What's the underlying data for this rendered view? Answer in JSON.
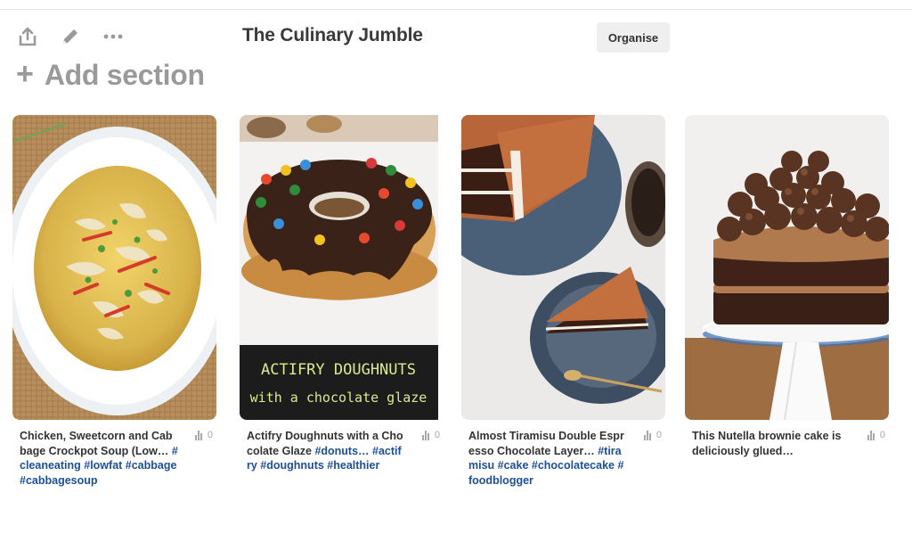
{
  "board": {
    "title": "The Culinary Jumble",
    "organise_label": "Organise",
    "add_section_label": "Add section"
  },
  "toolbar": {
    "icons": [
      "share-icon",
      "edit-pencil-icon",
      "more-options-icon"
    ]
  },
  "pins": [
    {
      "description": "Chicken, Sweetcorn and Cabbage Crockpot Soup (Low…",
      "tags": "#cleaneating #lowfat #cabbage #cabbagesoup",
      "stat": "0"
    },
    {
      "description": "Actifry Doughnuts with a Chocolate Glaze",
      "tags": "#donuts… #actifry #doughnuts #healthier",
      "stat": "0",
      "image_text_1": "ACTIFRY DOUGHNUTS",
      "image_text_2": "with a chocolate glaze"
    },
    {
      "description": "Almost Tiramisu Double Espresso Chocolate Layer…",
      "tags": "#tiramisu #cake #chocolatecake #foodblogger",
      "stat": "0"
    },
    {
      "description": "This Nutella brownie cake is deliciously glued…",
      "tags": "",
      "stat": "0"
    }
  ],
  "colors": {
    "tag_link": "#1d4f9a",
    "button_bg": "#efefef",
    "muted_grey": "#9a9a9a"
  }
}
